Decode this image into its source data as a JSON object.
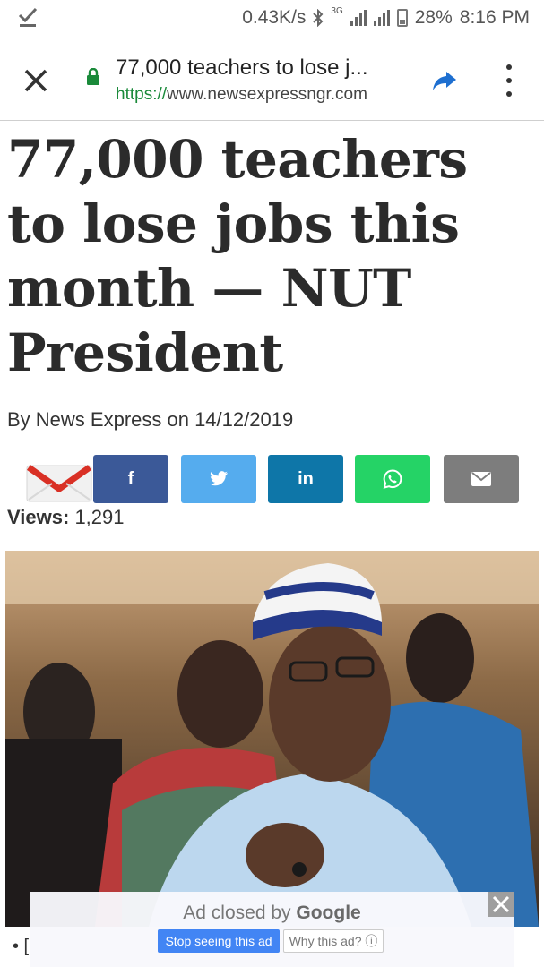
{
  "status_bar": {
    "speed": "0.43K/s",
    "network": "3G",
    "battery": "28%",
    "time": "8:16 PM",
    "icons": [
      "download-done-icon",
      "bluetooth-icon",
      "signal-icon",
      "battery-charging-icon"
    ]
  },
  "browser": {
    "page_title": "77,000 teachers to lose j...",
    "url_scheme": "https://",
    "url_host": "www.newsexpressngr.com",
    "icons": [
      "close-icon",
      "lock-icon",
      "share-icon",
      "more-vert-icon"
    ],
    "lock_color": "#1a8a3a",
    "share_color": "#1e6fd0"
  },
  "article": {
    "headline": "77,000 teachers to lose jobs this month — NUT President",
    "byline": "By News Express on 14/12/2019",
    "views_label": "Views:",
    "views_value": "1,291"
  },
  "share_buttons": [
    {
      "name": "gmail",
      "icon": "gmail-icon"
    },
    {
      "name": "facebook",
      "label": "f",
      "color": "#3b5998"
    },
    {
      "name": "twitter",
      "icon": "twitter-icon",
      "color": "#55acee"
    },
    {
      "name": "linkedin",
      "label": "in",
      "color": "#0e76a8"
    },
    {
      "name": "whatsapp",
      "icon": "whatsapp-icon",
      "color": "#25d366"
    },
    {
      "name": "email",
      "icon": "mail-icon",
      "color": "#7d7d7d"
    }
  ],
  "ad": {
    "closed_by_prefix": "Ad closed by",
    "closed_by_brand": "Google",
    "stop_label": "Stop seeing this ad",
    "why_label": "Why this ad? ⓘ",
    "close_icon": "close-icon"
  },
  "bullet_text": "• [",
  "colors": {
    "headline": "#2b2b2b",
    "ad_button": "#4285f4"
  }
}
